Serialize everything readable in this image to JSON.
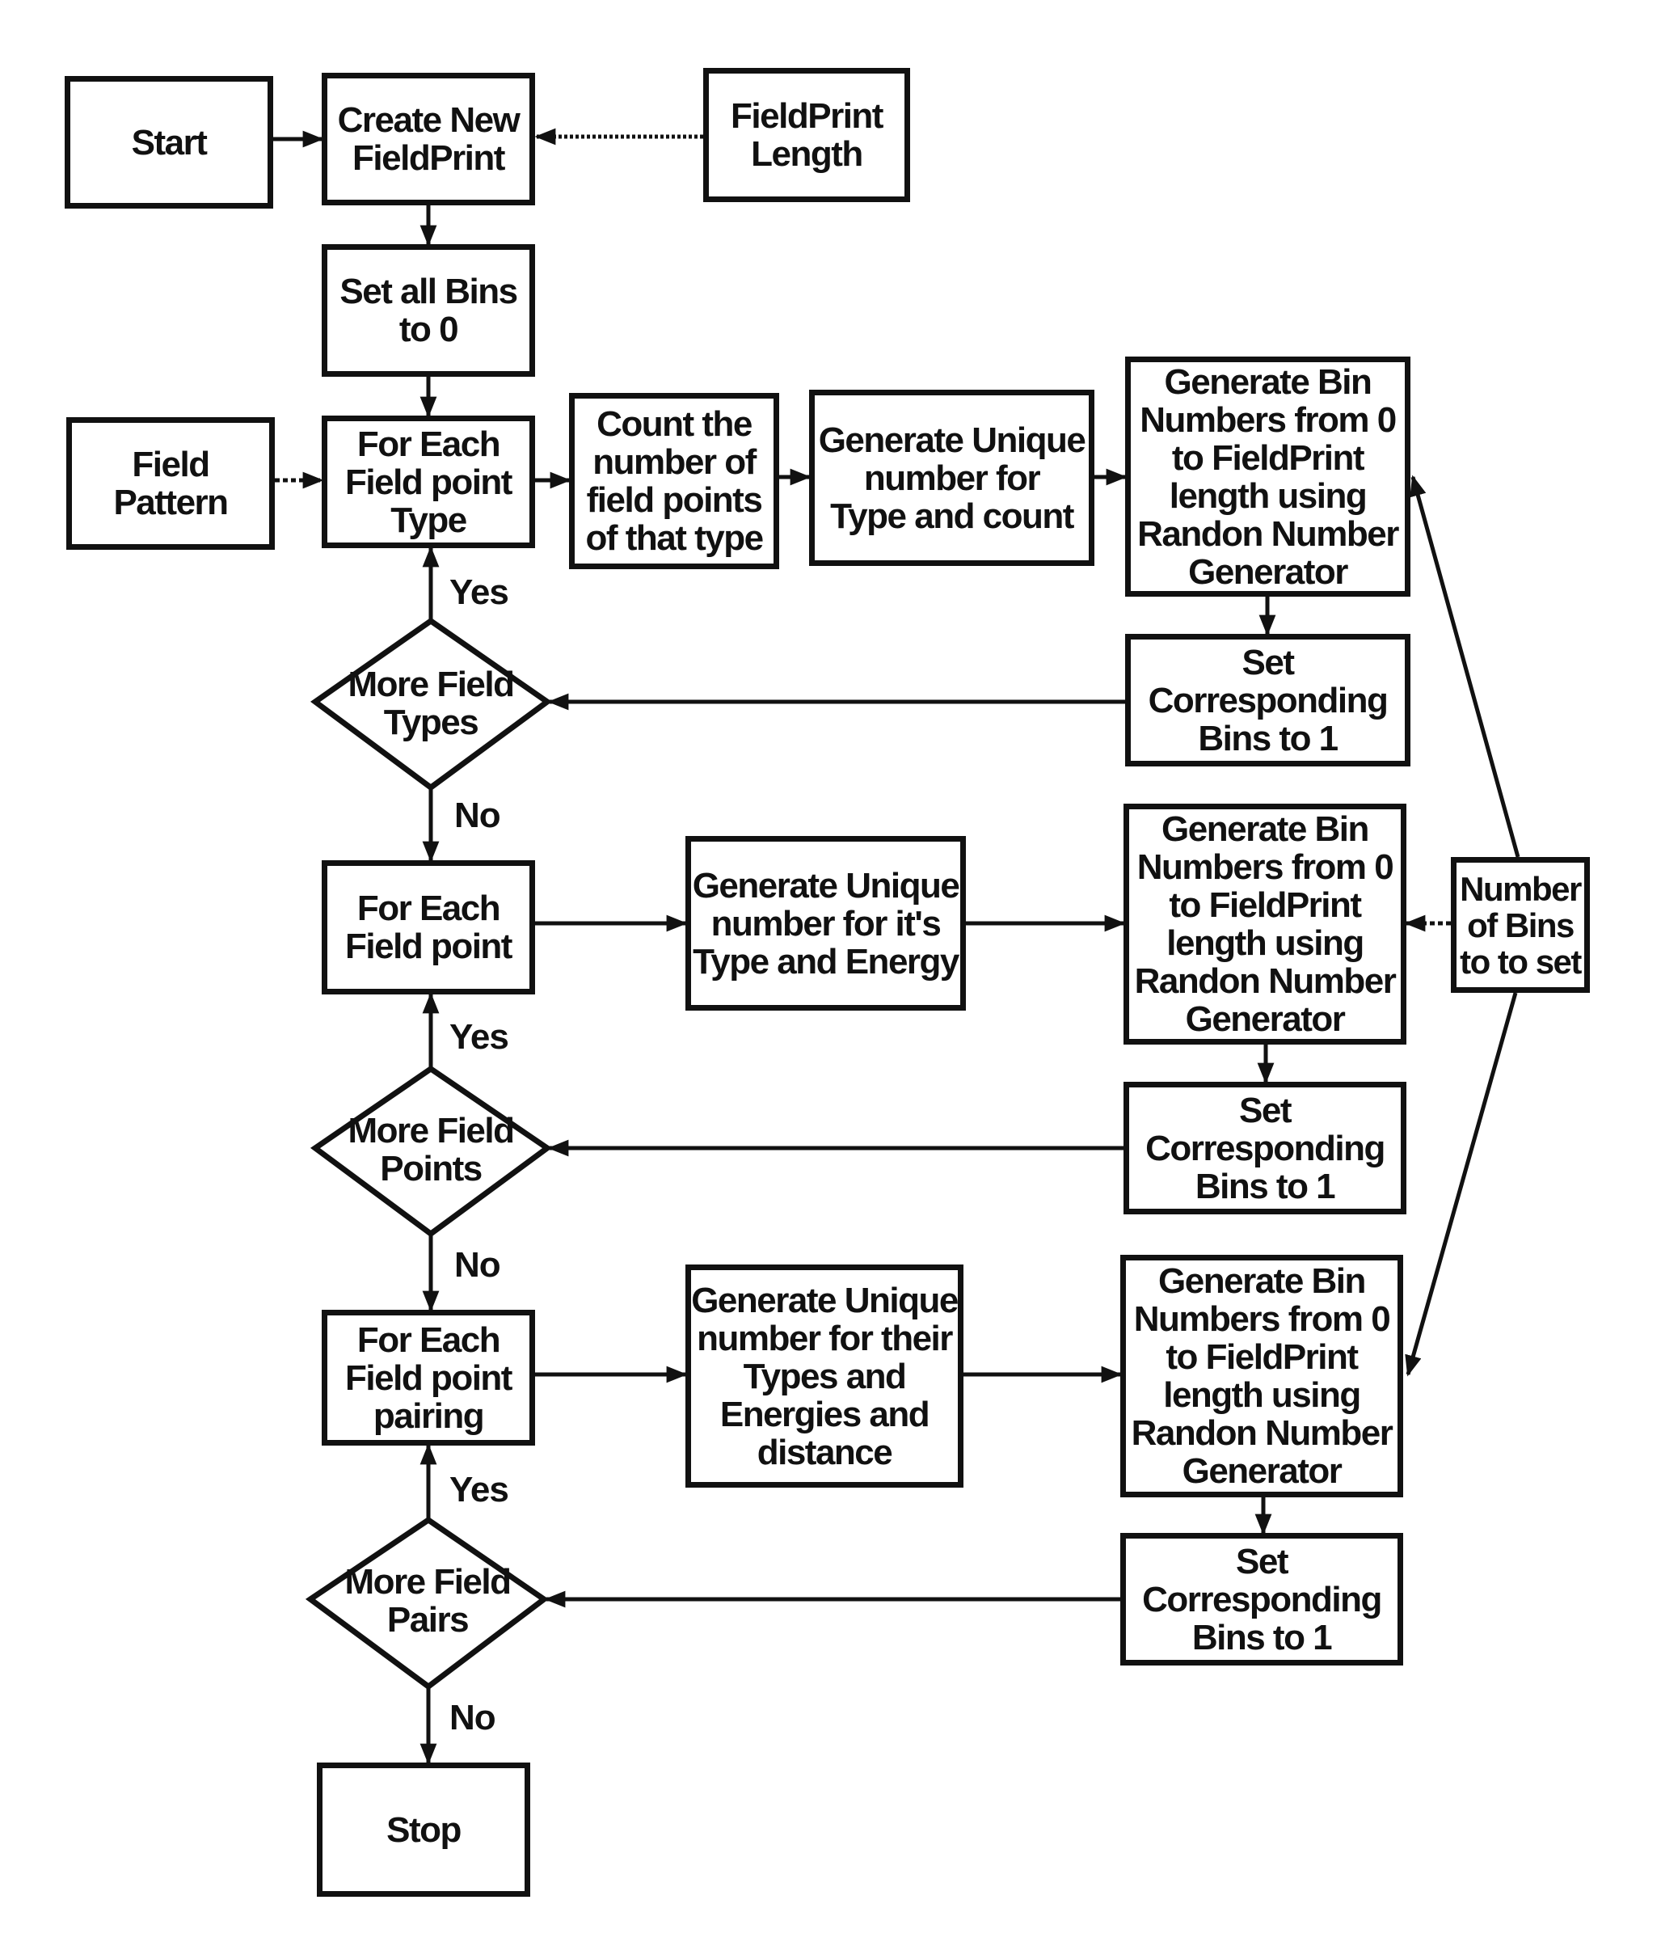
{
  "nodes": {
    "start": "Start",
    "create": "Create New\nFieldPrint",
    "length": "FieldPrint\nLength",
    "setzero": "Set all Bins\nto 0",
    "pattern": "Field Pattern",
    "foreach_type": "For Each\nField point\nType",
    "count": "Count the\nnumber of\nfield points\nof that type",
    "gen_type": "Generate Unique\nnumber for\nType and count",
    "bin1": "Generate Bin\nNumbers from 0\nto FieldPrint\nlength using\nRandon Number\nGenerator",
    "set1": "Set\nCorresponding\nBins to 1",
    "more_types": "More Field\nTypes",
    "foreach_point": "For Each\nField point",
    "gen_energy": "Generate Unique\nnumber for it's\nType and Energy",
    "bin2": "Generate Bin\nNumbers from 0\nto FieldPrint\nlength using\nRandon Number\nGenerator",
    "set2": "Set\nCorresponding\nBins to 1",
    "nbins": "Number\nof Bins\nto to set",
    "more_points": "More Field\nPoints",
    "foreach_pair": "For Each\nField point\npairing",
    "gen_pair": "Generate Unique\nnumber for their\nTypes and\nEnergies and\ndistance",
    "bin3": "Generate Bin\nNumbers from 0\nto FieldPrint\nlength using\nRandon Number\nGenerator",
    "set3": "Set\nCorresponding\nBins to 1",
    "more_pairs": "More Field\nPairs",
    "stop": "Stop"
  },
  "labels": {
    "yes1": "Yes",
    "no1": "No",
    "yes2": "Yes",
    "no2": "No",
    "yes3": "Yes",
    "no3": "No"
  }
}
